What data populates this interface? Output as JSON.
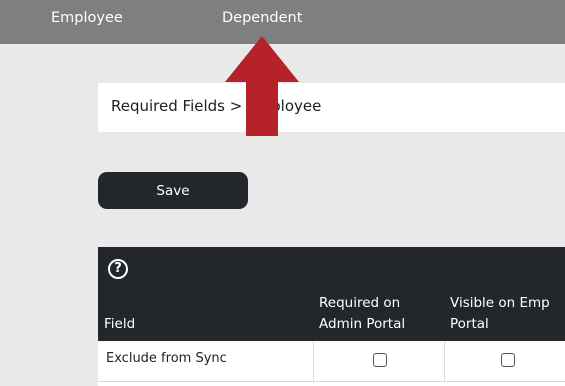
{
  "topnav": {
    "tabs": [
      {
        "label": "Employee"
      },
      {
        "label": "Dependent"
      }
    ]
  },
  "breadcrumb": {
    "text": "Required Fields > Employee"
  },
  "toolbar": {
    "save_label": "Save"
  },
  "table": {
    "help_icon": "question-circle-icon",
    "headers": {
      "field": "Field",
      "admin": "Required on Admin Portal",
      "emp": "Visible on Emp Portal"
    },
    "rows": [
      {
        "field": "Exclude from Sync",
        "required_admin": false,
        "visible_emp": false
      }
    ]
  },
  "annotation": {
    "arrow_color": "#b5222a",
    "icon": "arrow-up-icon"
  },
  "colors": {
    "topbar": "#7f7f7f",
    "dark": "#23272c",
    "background": "#e9e9e9"
  }
}
